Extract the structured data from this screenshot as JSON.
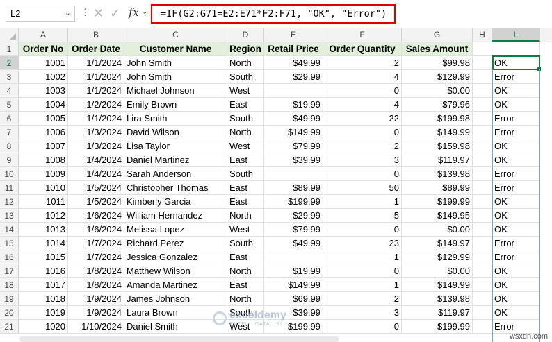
{
  "name_box": "L2",
  "formula": "=IF(G2:G71=E2:E71*F2:F71, \"OK\", \"Error\")",
  "column_letters": [
    "A",
    "B",
    "C",
    "D",
    "E",
    "F",
    "G",
    "H",
    "L"
  ],
  "headers": [
    "Order No",
    "Order Date",
    "Customer Name",
    "Region",
    "Retail Price",
    "Order Quantity",
    "Sales Amount"
  ],
  "rows": [
    {
      "n": "2",
      "a": "1001",
      "b": "1/1/2024",
      "c": "John Smith",
      "d": "North",
      "e": "$49.99",
      "f": "2",
      "g": "$99.98",
      "l": "OK"
    },
    {
      "n": "3",
      "a": "1002",
      "b": "1/1/2024",
      "c": "John Smith",
      "d": "South",
      "e": "$29.99",
      "f": "4",
      "g": "$129.99",
      "l": "Error"
    },
    {
      "n": "4",
      "a": "1003",
      "b": "1/1/2024",
      "c": "Michael Johnson",
      "d": "West",
      "e": "",
      "f": "0",
      "g": "$0.00",
      "l": "OK"
    },
    {
      "n": "5",
      "a": "1004",
      "b": "1/2/2024",
      "c": "Emily Brown",
      "d": "East",
      "e": "$19.99",
      "f": "4",
      "g": "$79.96",
      "l": "OK"
    },
    {
      "n": "6",
      "a": "1005",
      "b": "1/1/2024",
      "c": "Lira Smith",
      "d": "South",
      "e": "$49.99",
      "f": "22",
      "g": "$199.98",
      "l": "Error"
    },
    {
      "n": "7",
      "a": "1006",
      "b": "1/3/2024",
      "c": "David Wilson",
      "d": "North",
      "e": "$149.99",
      "f": "0",
      "g": "$149.99",
      "l": "Error"
    },
    {
      "n": "8",
      "a": "1007",
      "b": "1/3/2024",
      "c": "Lisa Taylor",
      "d": "West",
      "e": "$79.99",
      "f": "2",
      "g": "$159.98",
      "l": "OK"
    },
    {
      "n": "9",
      "a": "1008",
      "b": "1/4/2024",
      "c": "Daniel Martinez",
      "d": "East",
      "e": "$39.99",
      "f": "3",
      "g": "$119.97",
      "l": "OK"
    },
    {
      "n": "10",
      "a": "1009",
      "b": "1/4/2024",
      "c": "Sarah Anderson",
      "d": "South",
      "e": "",
      "f": "0",
      "g": "$139.98",
      "l": "Error"
    },
    {
      "n": "11",
      "a": "1010",
      "b": "1/5/2024",
      "c": "Christopher Thomas",
      "d": "East",
      "e": "$89.99",
      "f": "50",
      "g": "$89.99",
      "l": "Error"
    },
    {
      "n": "12",
      "a": "1011",
      "b": "1/5/2024",
      "c": "Kimberly Garcia",
      "d": "East",
      "e": "$199.99",
      "f": "1",
      "g": "$199.99",
      "l": "OK"
    },
    {
      "n": "13",
      "a": "1012",
      "b": "1/6/2024",
      "c": "William Hernandez",
      "d": "North",
      "e": "$29.99",
      "f": "5",
      "g": "$149.95",
      "l": "OK"
    },
    {
      "n": "14",
      "a": "1013",
      "b": "1/6/2024",
      "c": "Melissa Lopez",
      "d": "West",
      "e": "$79.99",
      "f": "0",
      "g": "$0.00",
      "l": "OK"
    },
    {
      "n": "15",
      "a": "1014",
      "b": "1/7/2024",
      "c": "Richard Perez",
      "d": "South",
      "e": "$49.99",
      "f": "23",
      "g": "$149.97",
      "l": "Error"
    },
    {
      "n": "16",
      "a": "1015",
      "b": "1/7/2024",
      "c": "Jessica Gonzalez",
      "d": "East",
      "e": "",
      "f": "1",
      "g": "$129.99",
      "l": "Error"
    },
    {
      "n": "17",
      "a": "1016",
      "b": "1/8/2024",
      "c": "Matthew Wilson",
      "d": "North",
      "e": "$19.99",
      "f": "0",
      "g": "$0.00",
      "l": "OK"
    },
    {
      "n": "18",
      "a": "1017",
      "b": "1/8/2024",
      "c": "Amanda Martinez",
      "d": "East",
      "e": "$149.99",
      "f": "1",
      "g": "$149.99",
      "l": "OK"
    },
    {
      "n": "19",
      "a": "1018",
      "b": "1/9/2024",
      "c": "James Johnson",
      "d": "North",
      "e": "$69.99",
      "f": "2",
      "g": "$139.98",
      "l": "OK"
    },
    {
      "n": "20",
      "a": "1019",
      "b": "1/9/2024",
      "c": "Laura Brown",
      "d": "South",
      "e": "$39.99",
      "f": "3",
      "g": "$119.97",
      "l": "OK"
    },
    {
      "n": "21",
      "a": "1020",
      "b": "1/10/2024",
      "c": "Daniel Smith",
      "d": "West",
      "e": "$199.99",
      "f": "0",
      "g": "$199.99",
      "l": "Error"
    }
  ],
  "watermark": {
    "brand": "exceldemy",
    "tagline": "EXCEL · DATA · BI"
  },
  "footer_watermark": "wsxdn.com"
}
